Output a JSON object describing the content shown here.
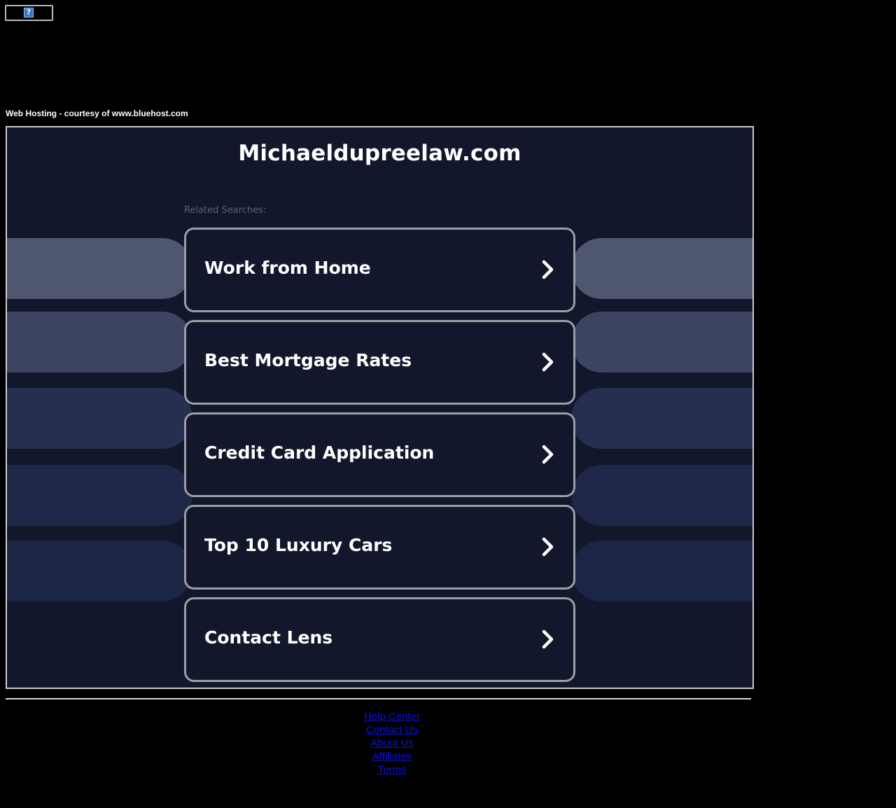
{
  "broken_image": {
    "icon": "broken-image-question-icon",
    "glyph": "?"
  },
  "courtesy_text": "Web Hosting - courtesy of www.bluehost.com",
  "site": {
    "title": "Michaeldupreelaw.com",
    "related_label": "Related Searches:"
  },
  "searches": [
    {
      "label": "Work from Home",
      "icon": "chevron-right-icon"
    },
    {
      "label": "Best Mortgage Rates",
      "icon": "chevron-right-icon"
    },
    {
      "label": "Credit Card Application",
      "icon": "chevron-right-icon"
    },
    {
      "label": "Top 10 Luxury Cars",
      "icon": "chevron-right-icon"
    },
    {
      "label": "Contact Lens",
      "icon": "chevron-right-icon"
    }
  ],
  "band_colors": [
    "#4e5670",
    "#3c4462",
    "#262f4f",
    "#1f2748",
    "#1c2546"
  ],
  "colors": {
    "page_bg": "#000000",
    "panel_bg": "#12172b",
    "button_border": "#9c9ea6",
    "link": "#1010d8"
  },
  "footer_links": [
    {
      "label": "Help Center"
    },
    {
      "label": "Contact Us"
    },
    {
      "label": "About Us"
    },
    {
      "label": "Affiliates"
    },
    {
      "label": "Terms"
    }
  ]
}
